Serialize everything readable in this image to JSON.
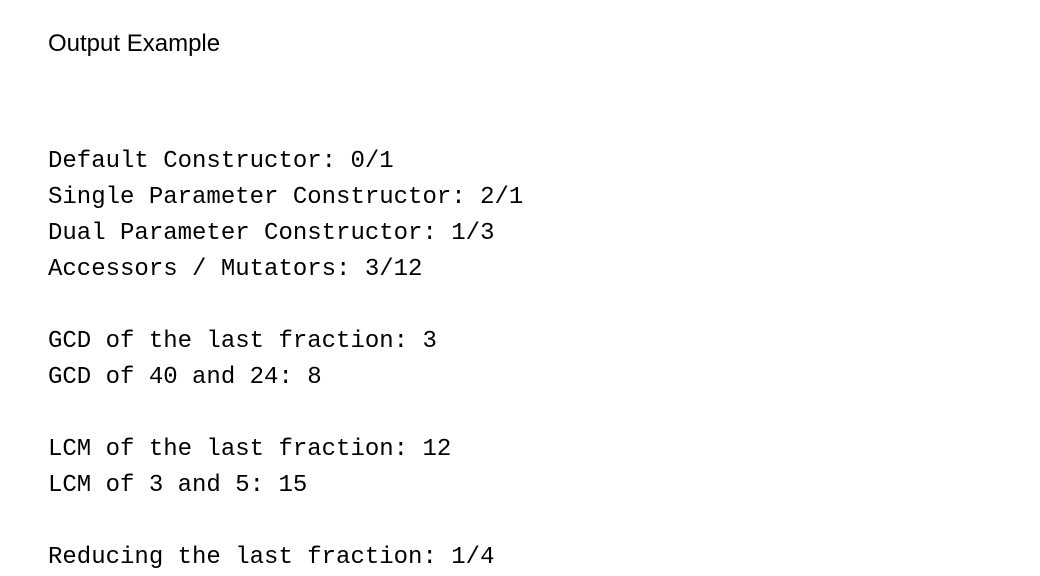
{
  "title": "Output Example",
  "lines": {
    "l0": "Default Constructor: 0/1",
    "l1": "Single Parameter Constructor: 2/1",
    "l2": "Dual Parameter Constructor: 1/3",
    "l3": "Accessors / Mutators: 3/12",
    "l4": "",
    "l5": "GCD of the last fraction: 3",
    "l6": "GCD of 40 and 24: 8",
    "l7": "",
    "l8": "LCM of the last fraction: 12",
    "l9": "LCM of 3 and 5: 15",
    "l10": "",
    "l11": "Reducing the last fraction: 1/4"
  }
}
